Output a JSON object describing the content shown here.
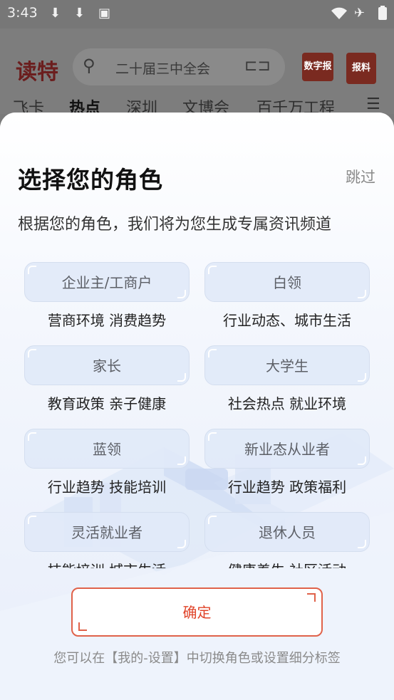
{
  "status_bar": {
    "time": "3:43",
    "left_icons": [
      "download-icon",
      "download-icon",
      "keyboard-icon"
    ],
    "right_icons": [
      "wifi-icon",
      "airplane-icon",
      "battery-icon"
    ]
  },
  "app_header": {
    "logo_text": "读特",
    "search_placeholder": "二十届三中全会",
    "digital_paper_label": "数字报",
    "report_label": "报料",
    "tabs": [
      "飞卡",
      "热点",
      "深圳",
      "文博会",
      "百千万工程"
    ],
    "active_tab": "热点"
  },
  "role_sheet": {
    "title": "选择您的角色",
    "skip_label": "跳过",
    "subtitle": "根据您的角色，我们将为您生成专属资讯频道",
    "roles": [
      {
        "label": "企业主/工商户",
        "desc": "营商环境 消费趋势"
      },
      {
        "label": "白领",
        "desc": "行业动态、城市生活"
      },
      {
        "label": "家长",
        "desc": "教育政策 亲子健康"
      },
      {
        "label": "大学生",
        "desc": "社会热点 就业环境"
      },
      {
        "label": "蓝领",
        "desc": "行业趋势 技能培训"
      },
      {
        "label": "新业态从业者",
        "desc": "行业趋势 政策福利"
      },
      {
        "label": "灵活就业者",
        "desc": "技能培训 城市生活"
      },
      {
        "label": "退休人员",
        "desc": "健康养生 社区活动"
      }
    ],
    "confirm_label": "确定",
    "footnote": "您可以在【我的-设置】中切换角色或设置细分标签"
  },
  "colors": {
    "accent": "#e0442a",
    "card_bg": "#e1e9f8",
    "overlay": "#7a7a7a"
  }
}
